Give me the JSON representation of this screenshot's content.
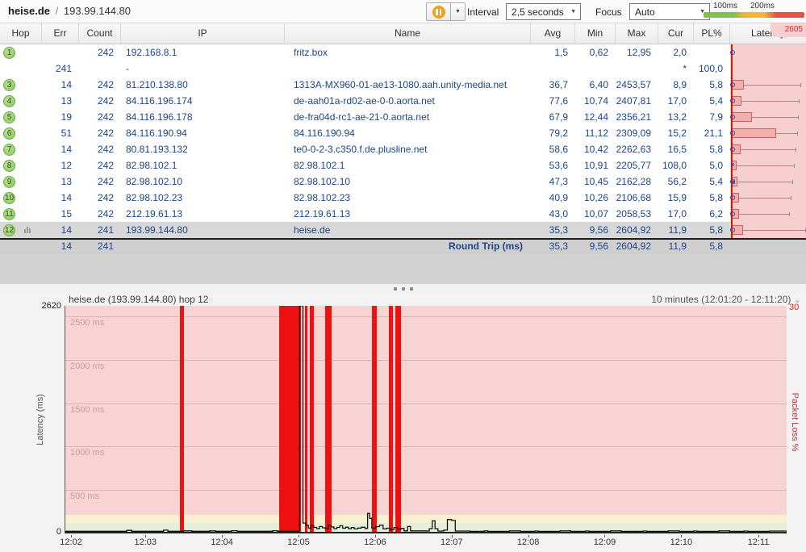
{
  "toolbar": {
    "target_host": "heise.de",
    "target_separator": "/",
    "target_ip": "193.99.144.80",
    "interval_label": "Interval",
    "interval_value": "2,5 seconds",
    "focus_label": "Focus",
    "focus_value": "Auto",
    "legend": {
      "label_100": "100ms",
      "label_200": "200ms"
    }
  },
  "colors": {
    "good_green": "#7fc24c",
    "warn_yellow": "#f2b632",
    "bad_red": "#e85048",
    "loss_bar_red": "#ee1111",
    "table_text_navy": "#1c4587",
    "pause_orange": "#f0a01e",
    "latency_zone_pink": "#f8d3d3"
  },
  "table": {
    "columns": [
      "Hop",
      "Err",
      "Count",
      "IP",
      "Name",
      "Avg",
      "Min",
      "Max",
      "Cur",
      "PL%",
      "Latency"
    ],
    "latency_scale_max": "2605",
    "rows": [
      {
        "hop": "1",
        "err": "",
        "count": "242",
        "ip": "192.168.8.1",
        "name": "fritz.box",
        "avg": "1,5",
        "min": "0,62",
        "max": "12,95",
        "cur": "2,0",
        "pl": "",
        "lat": {
          "box": 0,
          "whisker": 0,
          "marker": "circle"
        }
      },
      {
        "hop": "",
        "err": "241",
        "count": "",
        "ip": "-",
        "name": "",
        "avg": "",
        "min": "",
        "max": "",
        "cur": "*",
        "pl": "100,0",
        "lat": null
      },
      {
        "hop": "3",
        "err": "14",
        "count": "242",
        "ip": "81.210.138.80",
        "name": "1313A-MX960-01-ae13-1080.aah.unity-media.net",
        "avg": "36,7",
        "min": "6,40",
        "max": "2453,57",
        "cur": "8,9",
        "pl": "5,8",
        "lat": {
          "box": 0.17,
          "whisker": 0.94,
          "marker": "circle"
        }
      },
      {
        "hop": "4",
        "err": "13",
        "count": "242",
        "ip": "84.116.196.174",
        "name": "de-aah01a-rd02-ae-0-0.aorta.net",
        "avg": "77,6",
        "min": "10,74",
        "max": "2407,81",
        "cur": "17,0",
        "pl": "5,4",
        "lat": {
          "box": 0.14,
          "whisker": 0.92,
          "marker": "circle"
        }
      },
      {
        "hop": "5",
        "err": "19",
        "count": "242",
        "ip": "84.116.196.178",
        "name": "de-fra04d-rc1-ae-21-0.aorta.net",
        "avg": "67,9",
        "min": "12,44",
        "max": "2356,21",
        "cur": "13,2",
        "pl": "7,9",
        "lat": {
          "box": 0.28,
          "whisker": 0.9,
          "marker": "circle"
        }
      },
      {
        "hop": "6",
        "err": "51",
        "count": "242",
        "ip": "84.116.190.94",
        "name": "84.116.190.94",
        "avg": "79,2",
        "min": "11,12",
        "max": "2309,09",
        "cur": "15,2",
        "pl": "21,1",
        "lat": {
          "box": 0.6,
          "whisker": 0.89,
          "marker": "circle"
        }
      },
      {
        "hop": "7",
        "err": "14",
        "count": "242",
        "ip": "80.81.193.132",
        "name": "te0-0-2-3.c350.f.de.plusline.net",
        "avg": "58,6",
        "min": "10,42",
        "max": "2262,63",
        "cur": "16,5",
        "pl": "5,8",
        "lat": {
          "box": 0.13,
          "whisker": 0.87,
          "marker": "circle"
        }
      },
      {
        "hop": "8",
        "err": "12",
        "count": "242",
        "ip": "82.98.102.1",
        "name": "82.98.102.1",
        "avg": "53,6",
        "min": "10,91",
        "max": "2205,77",
        "cur": "108,0",
        "pl": "5,0",
        "lat": {
          "box": 0.07,
          "whisker": 0.85,
          "marker": "x"
        }
      },
      {
        "hop": "9",
        "err": "13",
        "count": "242",
        "ip": "82.98.102.10",
        "name": "82.98.102.10",
        "avg": "47,3",
        "min": "10,45",
        "max": "2162,28",
        "cur": "56,2",
        "pl": "5,4",
        "lat": {
          "box": 0.08,
          "whisker": 0.83,
          "marker": "circle-x"
        }
      },
      {
        "hop": "10",
        "err": "14",
        "count": "242",
        "ip": "82.98.102.23",
        "name": "82.98.102.23",
        "avg": "40,9",
        "min": "10,26",
        "max": "2106,68",
        "cur": "15,9",
        "pl": "5,8",
        "lat": {
          "box": 0.11,
          "whisker": 0.81,
          "marker": "circle"
        }
      },
      {
        "hop": "11",
        "err": "15",
        "count": "242",
        "ip": "212.19.61.13",
        "name": "212.19.61.13",
        "avg": "43,0",
        "min": "10,07",
        "max": "2058,53",
        "cur": "17,0",
        "pl": "6,2",
        "lat": {
          "box": 0.11,
          "whisker": 0.79,
          "marker": "circle"
        }
      },
      {
        "hop": "12",
        "err": "14",
        "count": "241",
        "ip": "193.99.144.80",
        "name": "heise.de",
        "avg": "35,3",
        "min": "9,56",
        "max": "2604,92",
        "cur": "11,9",
        "pl": "5,8",
        "selected": true,
        "icon": "mini-chart",
        "lat": {
          "box": 0.16,
          "whisker": 1.0,
          "marker": "circle"
        }
      }
    ],
    "footer": {
      "err": "14",
      "count": "241",
      "label": "Round Trip (ms)",
      "avg": "35,3",
      "min": "9,56",
      "max": "2604,92",
      "cur": "11,9",
      "pl": "5,8"
    }
  },
  "chart_data": {
    "type": "line",
    "title": "heise.de (193.99.144.80) hop 12",
    "time_range_label": "10 minutes (12:01:20 - 12:11:20)",
    "ylabel": "Latency (ms)",
    "y2label": "Packet Loss %",
    "ylim": [
      0,
      2620
    ],
    "y_max_label": "2620",
    "y_min_label": "0",
    "y2_max_label": "30",
    "zones": {
      "green_max_ms": 100,
      "yellow_max_ms": 200
    },
    "gridlines": [
      {
        "ms": 2500,
        "label": "2500 ms"
      },
      {
        "ms": 2000,
        "label": "2000 ms"
      },
      {
        "ms": 1500,
        "label": "1500 ms"
      },
      {
        "ms": 1000,
        "label": "1000 ms"
      },
      {
        "ms": 500,
        "label": "500 ms"
      }
    ],
    "x_ticks": [
      {
        "label": "12:02",
        "frac": 0.009
      },
      {
        "label": "12:03",
        "frac": 0.112
      },
      {
        "label": "12:04",
        "frac": 0.218
      },
      {
        "label": "12:05",
        "frac": 0.324
      },
      {
        "label": "12:06",
        "frac": 0.43
      },
      {
        "label": "12:07",
        "frac": 0.536
      },
      {
        "label": "12:08",
        "frac": 0.642
      },
      {
        "label": "12:09",
        "frac": 0.748
      },
      {
        "label": "12:10",
        "frac": 0.854
      },
      {
        "label": "12:11",
        "frac": 0.961
      }
    ],
    "packet_loss_bars": [
      {
        "frac": 0.1587,
        "w": 0.0056
      },
      {
        "frac": 0.2961,
        "w": 0.0302
      },
      {
        "frac": 0.3318,
        "w": 0.0039
      },
      {
        "frac": 0.3391,
        "w": 0.0045
      },
      {
        "frac": 0.3598,
        "w": 0.0089
      },
      {
        "frac": 0.4246,
        "w": 0.0067
      },
      {
        "frac": 0.448,
        "w": 0.0061
      },
      {
        "frac": 0.4575,
        "w": 0.0078
      }
    ],
    "latency_series": [
      [
        0.0,
        25
      ],
      [
        0.06,
        25
      ],
      [
        0.085,
        35
      ],
      [
        0.092,
        25
      ],
      [
        0.13,
        25
      ],
      [
        0.136,
        38
      ],
      [
        0.142,
        25
      ],
      [
        0.155,
        25
      ],
      [
        0.163,
        30
      ],
      [
        0.175,
        25
      ],
      [
        0.2,
        30
      ],
      [
        0.208,
        25
      ],
      [
        0.23,
        32
      ],
      [
        0.238,
        25
      ],
      [
        0.28,
        25
      ],
      [
        0.287,
        32
      ],
      [
        0.294,
        25
      ],
      [
        0.322,
        28
      ],
      [
        0.3245,
        2620
      ],
      [
        0.329,
        120
      ],
      [
        0.333,
        95
      ],
      [
        0.3365,
        60
      ],
      [
        0.34,
        90
      ],
      [
        0.344,
        70
      ],
      [
        0.348,
        55
      ],
      [
        0.352,
        80
      ],
      [
        0.356,
        65
      ],
      [
        0.36,
        55
      ],
      [
        0.364,
        95
      ],
      [
        0.368,
        75
      ],
      [
        0.372,
        55
      ],
      [
        0.376,
        70
      ],
      [
        0.38,
        88
      ],
      [
        0.384,
        60
      ],
      [
        0.388,
        72
      ],
      [
        0.392,
        55
      ],
      [
        0.396,
        68
      ],
      [
        0.4,
        52
      ],
      [
        0.405,
        62
      ],
      [
        0.41,
        72
      ],
      [
        0.415,
        58
      ],
      [
        0.4185,
        230
      ],
      [
        0.4215,
        175
      ],
      [
        0.4245,
        60
      ],
      [
        0.43,
        78
      ],
      [
        0.435,
        95
      ],
      [
        0.44,
        52
      ],
      [
        0.445,
        60
      ],
      [
        0.45,
        42
      ],
      [
        0.455,
        68
      ],
      [
        0.46,
        50
      ],
      [
        0.465,
        58
      ],
      [
        0.469,
        30
      ],
      [
        0.474,
        80
      ],
      [
        0.478,
        30
      ],
      [
        0.5,
        28
      ],
      [
        0.504,
        55
      ],
      [
        0.508,
        145
      ],
      [
        0.512,
        55
      ],
      [
        0.516,
        28
      ],
      [
        0.524,
        38
      ],
      [
        0.529,
        160
      ],
      [
        0.535,
        150
      ],
      [
        0.54,
        28
      ],
      [
        0.56,
        24
      ],
      [
        0.58,
        30
      ],
      [
        0.585,
        24
      ],
      [
        0.61,
        24
      ],
      [
        0.615,
        30
      ],
      [
        0.63,
        24
      ],
      [
        0.65,
        28
      ],
      [
        0.655,
        24
      ],
      [
        0.68,
        24
      ],
      [
        0.685,
        30
      ],
      [
        0.7,
        24
      ],
      [
        0.72,
        28
      ],
      [
        0.725,
        24
      ],
      [
        0.75,
        24
      ],
      [
        0.755,
        30
      ],
      [
        0.77,
        24
      ],
      [
        0.8,
        28
      ],
      [
        0.805,
        24
      ],
      [
        0.83,
        24
      ],
      [
        0.835,
        30
      ],
      [
        0.85,
        24
      ],
      [
        0.87,
        28
      ],
      [
        0.875,
        24
      ],
      [
        0.9,
        24
      ],
      [
        0.905,
        30
      ],
      [
        0.92,
        24
      ],
      [
        0.94,
        28
      ],
      [
        0.945,
        24
      ],
      [
        0.97,
        24
      ],
      [
        0.975,
        28
      ],
      [
        1.0,
        24
      ]
    ]
  }
}
